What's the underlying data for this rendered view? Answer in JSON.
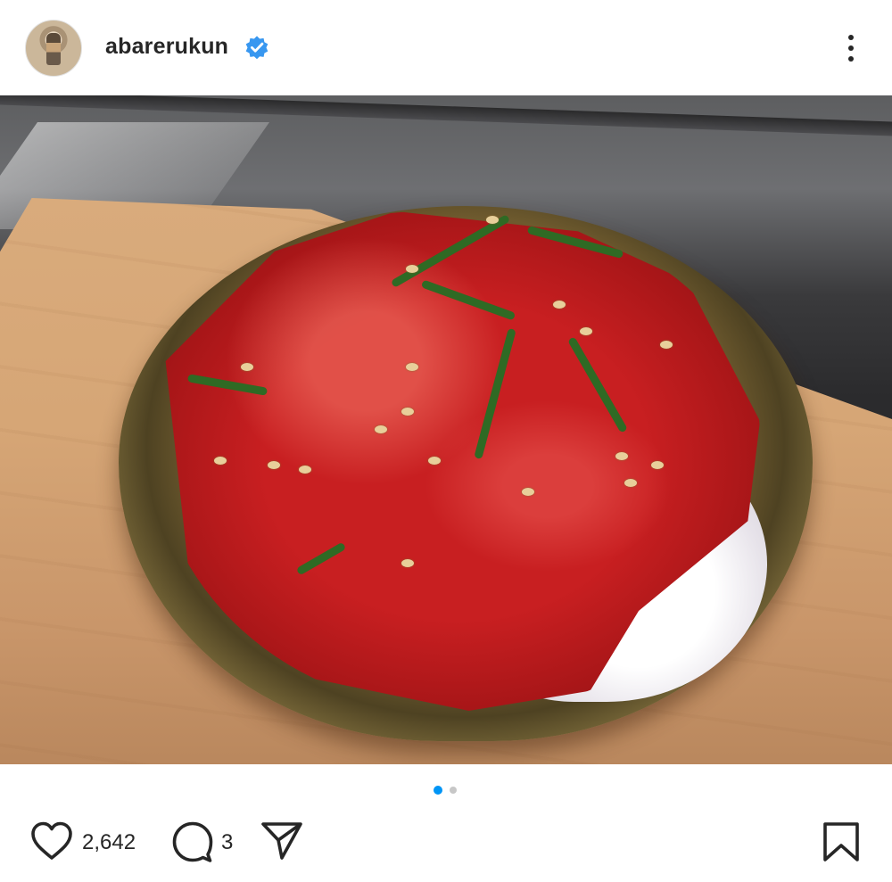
{
  "header": {
    "username": "abarerukun",
    "avatar_icon": "profile-avatar",
    "verified_icon": "verified-badge-icon",
    "more_icon": "more-options-icon",
    "verified_color": "#3897f0"
  },
  "post": {
    "image_alt": "bowl of marinated tuna over rice topped with shiso and sesame",
    "carousel": {
      "current": 1,
      "total": 2,
      "active_color": "#0095f6",
      "inactive_color": "#c7c7c7"
    }
  },
  "actions": {
    "like_icon": "heart-icon",
    "like_count": "2,642",
    "comment_icon": "comment-icon",
    "comment_count": "3",
    "share_icon": "send-icon",
    "save_icon": "bookmark-icon"
  }
}
